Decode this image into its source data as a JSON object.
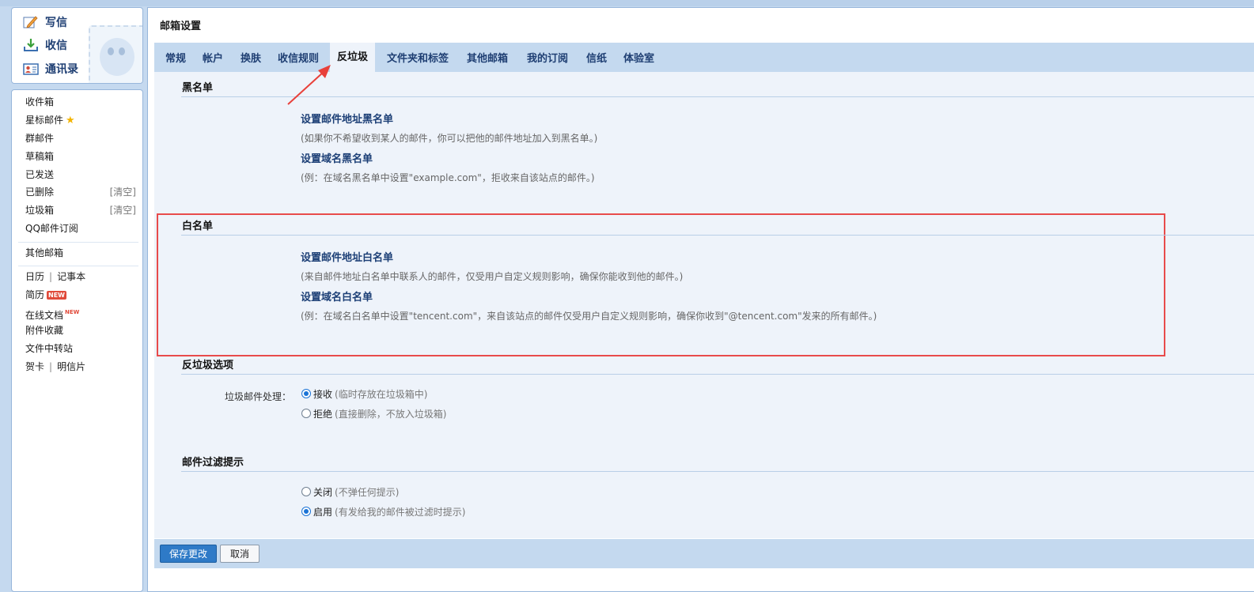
{
  "quick_actions": [
    {
      "label": "写信",
      "icon": "compose-icon"
    },
    {
      "label": "收信",
      "icon": "inbox-download-icon"
    },
    {
      "label": "通讯录",
      "icon": "contacts-card-icon"
    }
  ],
  "folders": {
    "inbox": "收件箱",
    "starred": "星标邮件",
    "group": "群邮件",
    "drafts": "草稿箱",
    "sent": "已发送",
    "deleted": "已删除",
    "deleted_clear": "[清空]",
    "spam": "垃圾箱",
    "spam_clear": "[清空]",
    "qq_subscribe": "QQ邮件订阅",
    "other_mailbox": "其他邮箱",
    "calendar": "日历",
    "separator": "|",
    "notes": "记事本",
    "resume": "简历",
    "resume_badge": "NEW",
    "online_docs": "在线文档",
    "online_docs_badge": "NEW",
    "attachments": "附件收藏",
    "file_transfer": "文件中转站",
    "cards": "贺卡",
    "postcards": "明信片"
  },
  "page": {
    "title": "邮箱设置"
  },
  "tabs": [
    "常规",
    "帐户",
    "换肤",
    "收信规则",
    "反垃圾",
    "文件夹和标签",
    "其他邮箱",
    "我的订阅",
    "信纸",
    "体验室"
  ],
  "active_tab": "反垃圾",
  "blacklist": {
    "title": "黑名单",
    "addr_link": "设置邮件地址黑名单",
    "addr_note": "(如果你不希望收到某人的邮件，你可以把他的邮件地址加入到黑名单。)",
    "domain_link": "设置域名黑名单",
    "domain_note": "(例：在域名黑名单中设置\"example.com\"，拒收来自该站点的邮件。)"
  },
  "whitelist": {
    "title": "白名单",
    "addr_link": "设置邮件地址白名单",
    "addr_note": "(来自邮件地址白名单中联系人的邮件，仅受用户自定义规则影响，确保你能收到他的邮件。)",
    "domain_link": "设置域名白名单",
    "domain_note": "(例：在域名白名单中设置\"tencent.com\"，来自该站点的邮件仅受用户自定义规则影响，确保你收到\"@tencent.com\"发来的所有邮件。)"
  },
  "antispam": {
    "title": "反垃圾选项",
    "label": "垃圾邮件处理：",
    "accept": "接收",
    "accept_hint": "(临时存放在垃圾箱中)",
    "reject": "拒绝",
    "reject_hint": "(直接删除，不放入垃圾箱)",
    "selected": "accept"
  },
  "filter_tip": {
    "title": "邮件过滤提示",
    "off": "关闭",
    "off_hint": "(不弹任何提示)",
    "on": "启用",
    "on_hint": "(有发给我的邮件被过滤时提示)",
    "selected": "on"
  },
  "footer": {
    "save": "保存更改",
    "cancel": "取消"
  },
  "colors": {
    "accent": "#2e7ac7",
    "highlight_box": "#e84b4b",
    "tab_bar": "#c4d9ef",
    "content_bg": "#eef3fa"
  }
}
